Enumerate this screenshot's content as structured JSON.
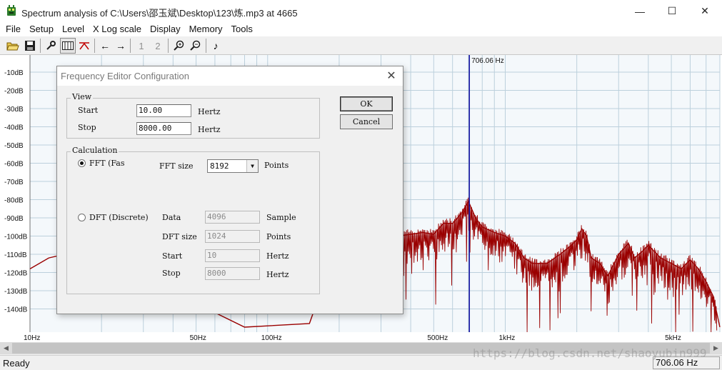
{
  "window": {
    "title": "Spectrum analysis of C:\\Users\\邵玉斌\\Desktop\\123\\炼.mp3 at 4665",
    "minimize_glyph": "—",
    "maximize_glyph": "☐",
    "close_glyph": "✕"
  },
  "menu": [
    "File",
    "Setup",
    "Level",
    "X Log scale",
    "Display",
    "Memory",
    "Tools"
  ],
  "toolbar": {
    "buttons": [
      "open-folder-icon",
      "save-icon",
      "wrench-icon",
      "waveform-box-icon",
      "cursor-icon",
      "arrow-left-icon",
      "arrow-right-icon",
      "zoom-in-icon",
      "zoom-out-icon",
      "note-icon"
    ],
    "memory_1": "1",
    "memory_2": "2",
    "arrow_left_glyph": "←",
    "arrow_right_glyph": "→",
    "note_glyph": "♪"
  },
  "plot": {
    "cursor_label": "706.06 Hz",
    "cursor_color": "#0a0aa0",
    "grid_color": "#bcd0dc",
    "trace_color": "#9a0000",
    "y_labels": [
      "-10dB",
      "-20dB",
      "-30dB",
      "-40dB",
      "-50dB",
      "-60dB",
      "-70dB",
      "-80dB",
      "-90dB",
      "-100dB",
      "-110dB",
      "-120dB",
      "-130dB",
      "-140dB"
    ],
    "x_labels": [
      "10Hz",
      "50Hz",
      "100Hz",
      "500Hz",
      "1kHz",
      "5kHz"
    ]
  },
  "chart_data": {
    "type": "line",
    "x_scale": "log",
    "xlim": [
      10,
      8000
    ],
    "ylim": [
      -150,
      -5
    ],
    "grid": true,
    "cursor_hz": 706.06,
    "series": [
      {
        "x": [
          10,
          12,
          14,
          17,
          20,
          25,
          30,
          40,
          60,
          80,
          150,
          200,
          250,
          300,
          350,
          400,
          450,
          500,
          550,
          600,
          650,
          700,
          750,
          800,
          900,
          1000,
          1100,
          1200,
          1300,
          1500,
          1700,
          1900,
          2000,
          2100,
          2200,
          2300,
          2500,
          2700,
          3000,
          3300,
          3500,
          3800,
          4000,
          4500,
          5000,
          5500,
          6000,
          6500,
          7000,
          7500,
          8000
        ],
        "y": [
          -118,
          -112,
          -110,
          -109,
          -109,
          -109,
          -112,
          -123,
          -142,
          -150,
          -148,
          -102,
          -98,
          -99,
          -100,
          -99,
          -98,
          -99,
          -93,
          -93,
          -88,
          -81,
          -90,
          -95,
          -98,
          -100,
          -104,
          -112,
          -115,
          -115,
          -110,
          -105,
          -102,
          -96,
          -100,
          -112,
          -115,
          -122,
          -110,
          -104,
          -112,
          -108,
          -105,
          -112,
          -115,
          -118,
          -113,
          -118,
          -125,
          -133,
          -150
        ]
      }
    ]
  },
  "dialog": {
    "title": "Frequency Editor Configuration",
    "close_glyph": "✕",
    "view_group": "View",
    "start_label": "Start",
    "start_value": "10.00",
    "start_unit": "Hertz",
    "stop_label": "Stop",
    "stop_value": "8000.00",
    "stop_unit": "Hertz",
    "calc_group": "Calculation",
    "fft_radio": "FFT (Fas",
    "fft_size_label": "FFT size",
    "fft_size_value": "8192",
    "fft_size_unit": "Points",
    "dft_radio": "DFT (Discrete)",
    "data_label": "Data",
    "data_value": "4096",
    "data_unit": "Sample",
    "dft_size_label": "DFT size",
    "dft_size_value": "1024",
    "dft_size_unit": "Points",
    "dft_start_label": "Start",
    "dft_start_value": "10",
    "dft_start_unit": "Hertz",
    "dft_stop_label": "Stop",
    "dft_stop_value": "8000",
    "dft_stop_unit": "Hertz",
    "ok": "OK",
    "cancel": "Cancel"
  },
  "scrollbar": {
    "left_glyph": "◀",
    "right_glyph": "▶"
  },
  "status": {
    "ready": "Ready",
    "frequency": "706.06 Hz"
  },
  "watermark": "https://blog.csdn.net/shaoyubin999"
}
